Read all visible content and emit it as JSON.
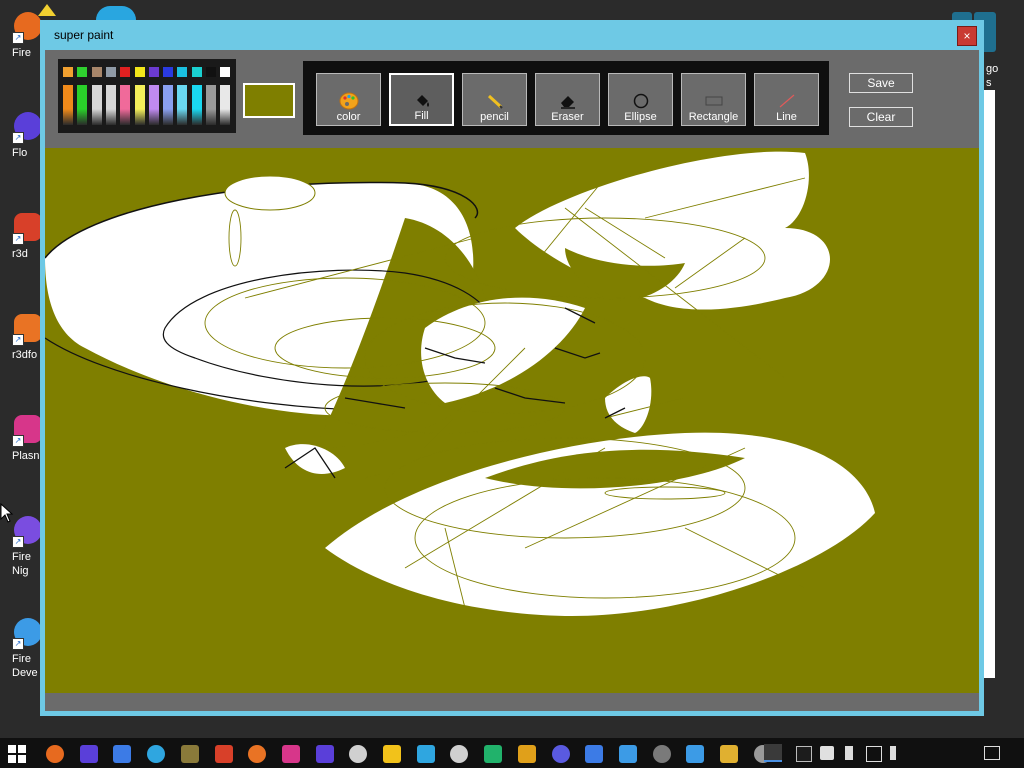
{
  "desktop": {
    "icons": [
      {
        "label": "Fire",
        "color": "#e76a1f"
      },
      {
        "label": "Flo",
        "color": "#5a3fd9"
      },
      {
        "label": "r3d",
        "color": "#d84029"
      },
      {
        "label": "r3dfo",
        "color": "#e97324"
      },
      {
        "label": "Plasn",
        "color": "#d7368a"
      },
      {
        "label": "Fire\nNig",
        "color": "#7a4de0"
      },
      {
        "label": "Fire\nDeve",
        "color": "#3c9be6"
      }
    ],
    "right_partial_label": "go\ns"
  },
  "window": {
    "title": "super paint",
    "close_label": "×"
  },
  "palette": {
    "top": [
      "#f0a030",
      "#2fd02f",
      "#a8866a",
      "#8f9aa6",
      "#e02020",
      "#f2e61a",
      "#6b3ad0",
      "#2a3ae0",
      "#1ac0e0",
      "#1ad0d0",
      "#111111",
      "#ffffff"
    ],
    "bottom": [
      "#f08a1a",
      "#2ad02a",
      "#d7d7d7",
      "#d7d7d7",
      "#f06a9a",
      "#f4ef5a",
      "#c08af0",
      "#8aa0f0",
      "#6ad8f0",
      "#1ad8f0",
      "#9a9a9a",
      "#e8e8e8"
    ]
  },
  "current_color": "#7f7f00",
  "tools": [
    {
      "id": "color",
      "label": "color",
      "icon": "palette-icon"
    },
    {
      "id": "fill",
      "label": "Fill",
      "icon": "fill-bucket-icon",
      "active": true
    },
    {
      "id": "pencil",
      "label": "pencil",
      "icon": "pencil-icon"
    },
    {
      "id": "eraser",
      "label": "Eraser",
      "icon": "eraser-icon"
    },
    {
      "id": "ellipse",
      "label": "Ellipse",
      "icon": "ellipse-icon"
    },
    {
      "id": "rectangle",
      "label": "Rectangle",
      "icon": "rectangle-icon"
    },
    {
      "id": "line",
      "label": "Line",
      "icon": "line-icon"
    }
  ],
  "buttons": {
    "save": "Save",
    "clear": "Clear"
  },
  "canvas": {
    "background": "#7f7f00",
    "stroke": "#000000",
    "fill": "#ffffff"
  },
  "taskbar": {
    "apps": [
      "#e76a1f",
      "#5a3fd9",
      "#3c7be6",
      "#2fa6e0",
      "#8a7a3a",
      "#d84029",
      "#e97324",
      "#d7368a",
      "#5a3fd9",
      "#d0d0d0",
      "#f2c21a",
      "#2fa6e0",
      "#d0d0d0",
      "#21b26b",
      "#e0a01a",
      "#5a5ae0",
      "#3c7be6",
      "#3c9be6",
      "#7a7a7a",
      "#3c9be6",
      "#e0b030",
      "#9a9a9a"
    ]
  }
}
